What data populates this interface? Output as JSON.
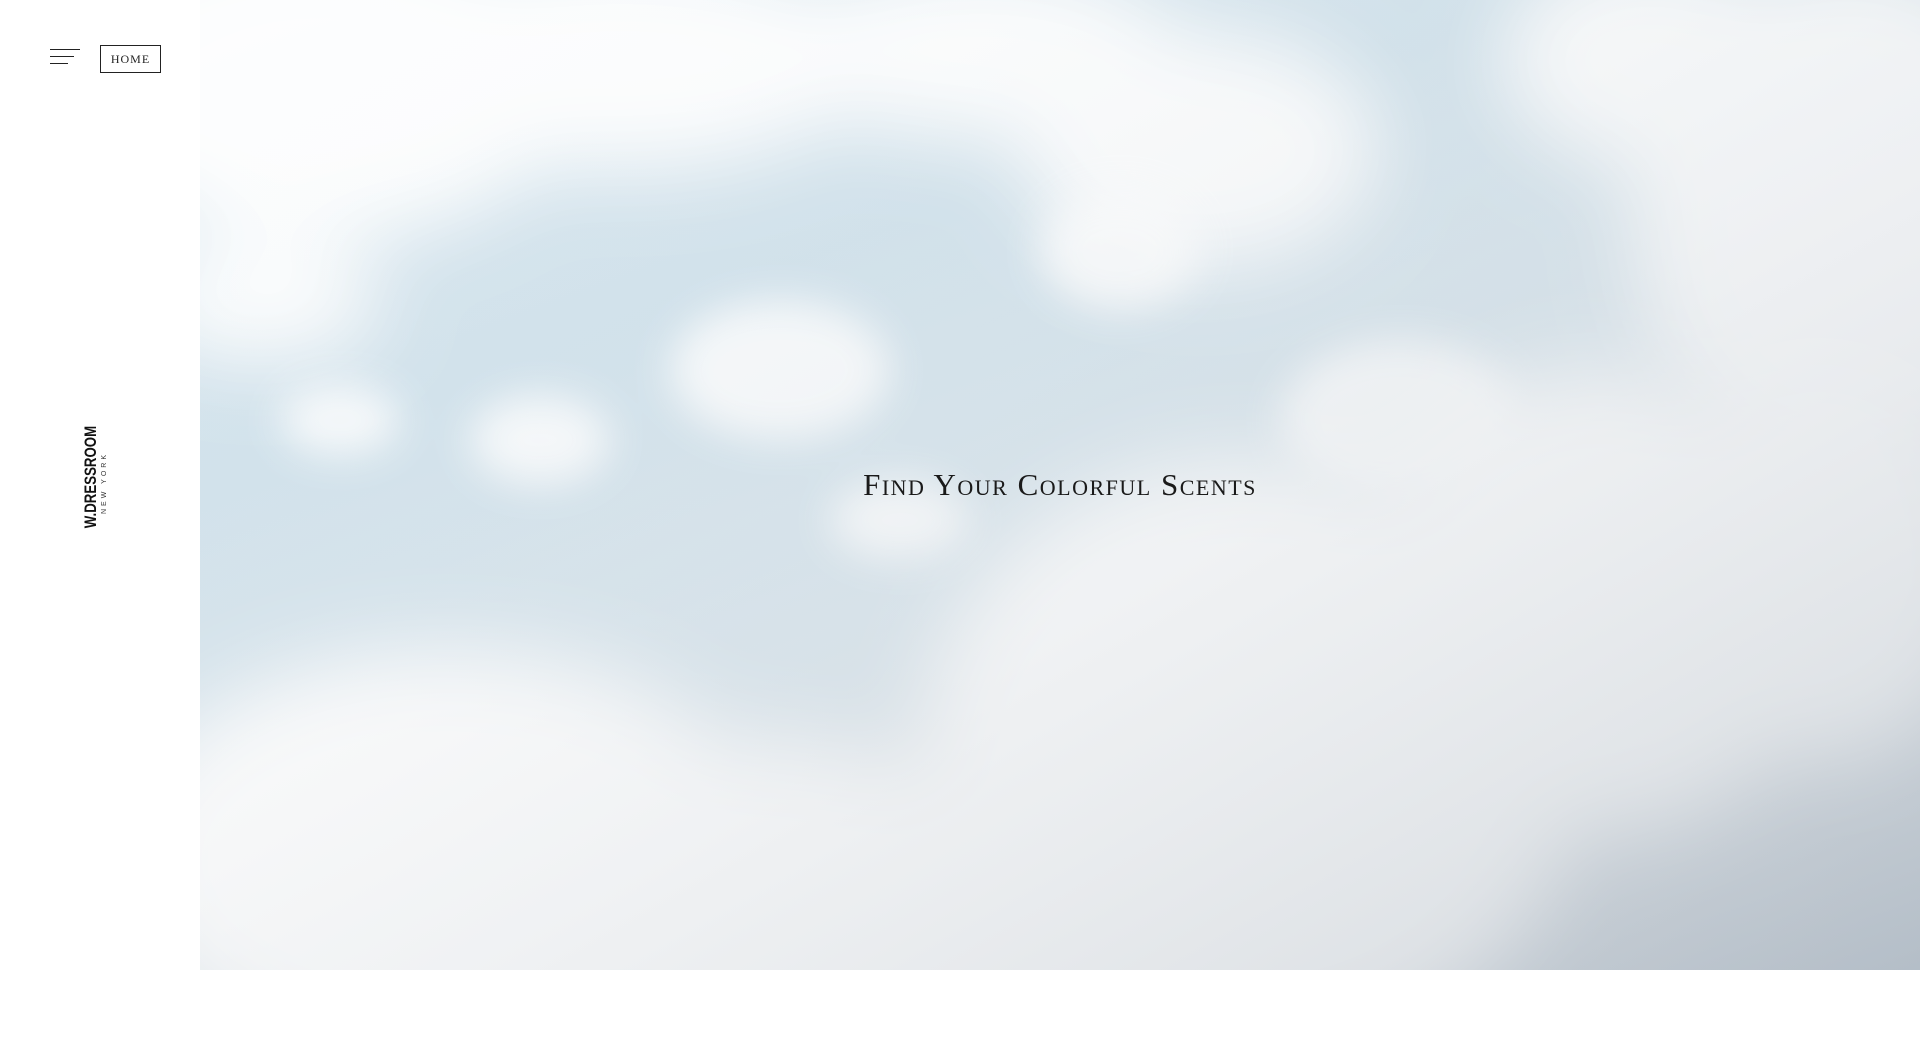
{
  "header": {
    "menu_icon": "hamburger-menu-icon",
    "home_label": "HOME"
  },
  "brand": {
    "name": "W.DRESSROOM",
    "city": "NEW YORK"
  },
  "hero": {
    "title": "Find Your Colorful Scents"
  },
  "colors": {
    "text": "#1a1a1a",
    "sky": "#cfe1eb",
    "background": "#ffffff"
  }
}
